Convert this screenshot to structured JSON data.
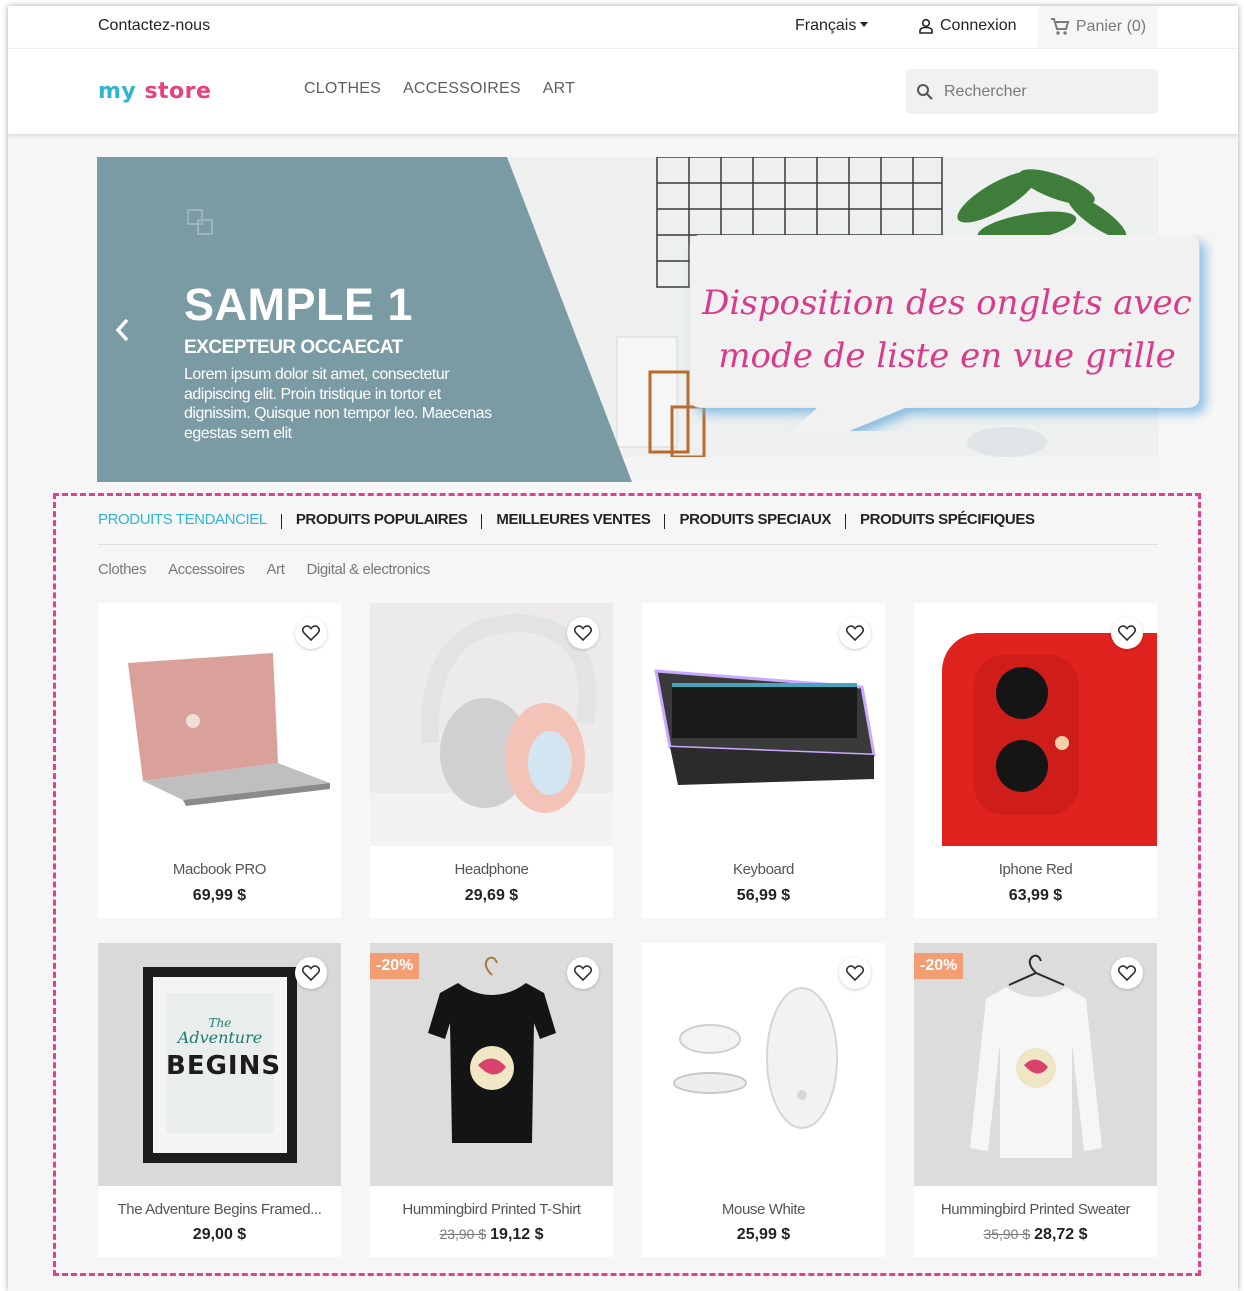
{
  "header": {
    "contact": "Contactez-nous",
    "language": "Français",
    "login": "Connexion",
    "cart": "Panier (0)"
  },
  "brand": {
    "logo_my": "my",
    "logo_store": "store"
  },
  "menu": [
    "CLOTHES",
    "ACCESSOIRES",
    "ART"
  ],
  "search": {
    "placeholder": "Rechercher"
  },
  "slider": {
    "title": "SAMPLE 1",
    "subtitle": "EXCEPTEUR OCCAECAT",
    "text": "Lorem ipsum dolor sit amet, consectetur adipiscing elit. Proin tristique in tortor et dignissim. Quisque non tempor leo. Maecenas egestas sem elit"
  },
  "callout": {
    "line1": "Disposition des onglets avec",
    "line2": "mode de liste en vue grille"
  },
  "tabs": [
    "PRODUITS TENDANCIEL",
    "PRODUITS POPULAIRES",
    "MEILLEURES VENTES",
    "PRODUITS SPECIAUX",
    "PRODUITS SPÉCIFIQUES"
  ],
  "subtabs": [
    "Clothes",
    "Accessoires",
    "Art",
    "Digital & electronics"
  ],
  "products": [
    {
      "name": "Macbook PRO",
      "price": "69,99 $"
    },
    {
      "name": "Headphone",
      "price": "29,69 $"
    },
    {
      "name": "Keyboard",
      "price": "56,99 $"
    },
    {
      "name": "Iphone Red",
      "price": "63,99 $"
    },
    {
      "name": "The Adventure Begins Framed...",
      "price": "29,00 $"
    },
    {
      "name": "Hummingbird Printed T-Shirt",
      "old_price": "23,90 $",
      "price": "19,12 $",
      "badge": "-20%"
    },
    {
      "name": "Mouse White",
      "price": "25,99 $"
    },
    {
      "name": "Hummingbird Printed Sweater",
      "old_price": "35,90 $",
      "price": "28,72 $",
      "badge": "-20%"
    }
  ],
  "poster_text": {
    "line1": "The",
    "line2": "Adventure",
    "line3": "BEGINS"
  },
  "colors": {
    "accent": "#2fb5d2",
    "highlight": "#e0418a",
    "badge": "#f39d72",
    "slider_panel": "#7a9aa4"
  }
}
